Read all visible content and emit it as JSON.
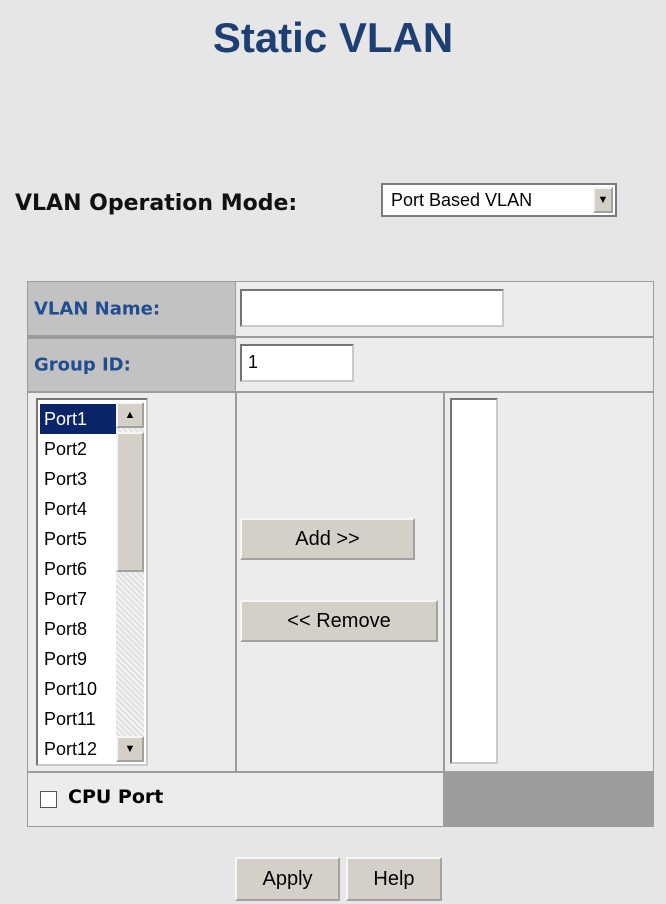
{
  "page": {
    "title": "Static VLAN"
  },
  "mode": {
    "label": "VLAN Operation Mode:",
    "selected": "Port Based VLAN"
  },
  "form": {
    "vlan_name_label": "VLAN Name:",
    "vlan_name_value": "",
    "group_id_label": "Group ID:",
    "group_id_value": "1"
  },
  "ports": [
    "Port1",
    "Port2",
    "Port3",
    "Port4",
    "Port5",
    "Port6",
    "Port7",
    "Port8",
    "Port9",
    "Port10",
    "Port11",
    "Port12"
  ],
  "buttons": {
    "add": "Add  >>",
    "remove": "<<  Remove",
    "apply": "Apply",
    "help": "Help"
  },
  "cpu_port": {
    "label": "CPU Port",
    "checked": false
  }
}
